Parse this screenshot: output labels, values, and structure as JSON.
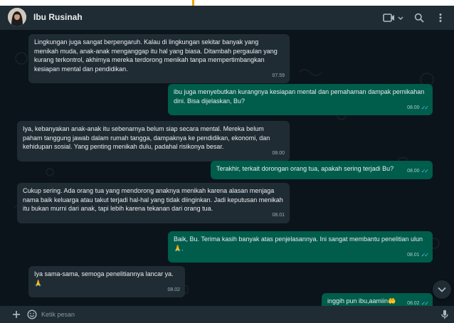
{
  "header": {
    "contact_name": "Ibu Rusinah"
  },
  "colors": {
    "header_bg": "#202c33",
    "chat_bg": "#0b141a",
    "incoming_bubble": "#202c33",
    "outgoing_bubble": "#005c4b",
    "read_ticks": "#53bdeb"
  },
  "icons": [
    "avatar",
    "video-call-icon",
    "chevron-down-icon",
    "search-icon",
    "menu-dots-icon",
    "plus-icon",
    "emoji-icon",
    "microphone-icon",
    "scroll-down-icon"
  ],
  "messages": [
    {
      "direction": "in",
      "text": "Lingkungan juga sangat berpengaruh. Kalau di lingkungan sekitar banyak yang menikah muda, anak-anak menganggap itu hal yang biasa. Ditambah pergaulan yang kurang terkontrol, akhirnya mereka terdorong menikah tanpa mempertimbangkan kesiapan mental dan pendidikan.",
      "time": "07.59"
    },
    {
      "direction": "out",
      "text": "ibu juga menyebutkan kurangnya kesiapan mental dan pemahaman dampak pernikahan dini. Bisa dijelaskan, Bu?",
      "time": "08.00",
      "ticks": "✓✓"
    },
    {
      "direction": "in",
      "text": "Iya, kebanyakan anak-anak itu sebenarnya belum siap secara mental. Mereka belum paham tanggung jawab dalam rumah tangga, dampaknya ke pendidikan, ekonomi, dan kehidupan sosial. Yang penting menikah dulu, padahal risikonya besar.",
      "time": "08.00"
    },
    {
      "direction": "out",
      "text": "Terakhir, terkait dorongan orang tua, apakah sering terjadi Bu?",
      "time": "08.00",
      "ticks": "✓✓"
    },
    {
      "direction": "in",
      "text": "Cukup sering. Ada orang tua yang mendorong anaknya menikah karena alasan menjaga nama baik keluarga atau takut terjadi hal-hal yang tidak diinginkan. Jadi keputusan menikah itu bukan murni dari anak, tapi lebih karena tekanan dari orang tua.",
      "time": "08.01"
    },
    {
      "direction": "out",
      "text": "Baik, Bu. Terima kasih banyak atas penjelasannya. Ini sangat membantu penelitian ulun 🙏.",
      "time": "08.01",
      "ticks": "✓✓"
    },
    {
      "direction": "in",
      "text": "Iya sama-sama, semoga penelitiannya lancar ya. 🙏",
      "time": "08.02"
    },
    {
      "direction": "out",
      "text": "inggih pun ibu,aamiin🤲",
      "time": "08.02",
      "ticks": "✓✓"
    }
  ],
  "composer": {
    "placeholder": "Ketik pesan"
  }
}
